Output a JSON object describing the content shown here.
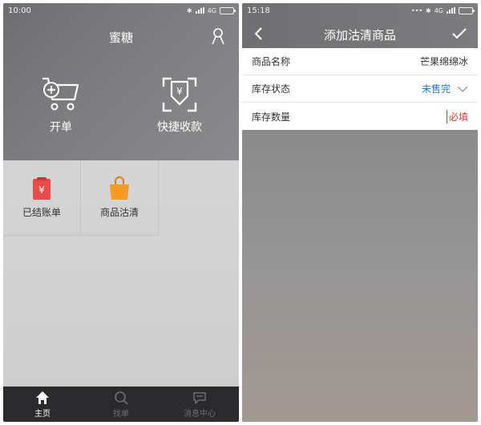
{
  "left": {
    "status": {
      "time": "10:00",
      "network": "4G"
    },
    "title": "蜜糖",
    "actions": [
      {
        "label": "开单",
        "icon": "cart-add-icon"
      },
      {
        "label": "快捷收款",
        "icon": "scan-pay-icon"
      }
    ],
    "grid": [
      {
        "label": "已结账单",
        "icon": "bill-icon",
        "color": "#e94b4b"
      },
      {
        "label": "商品沽清",
        "icon": "shopping-bag-icon",
        "color": "#f59a23"
      }
    ],
    "tabs": [
      {
        "label": "主页",
        "icon": "home-icon",
        "active": true
      },
      {
        "label": "找单",
        "icon": "search-icon",
        "active": false
      },
      {
        "label": "消息中心",
        "icon": "message-icon",
        "active": false
      }
    ]
  },
  "right": {
    "status": {
      "time": "15:18",
      "network": "4G"
    },
    "title": "添加沽清商品",
    "form": [
      {
        "label": "商品名称",
        "value": "芒果绵绵冰"
      },
      {
        "label": "库存状态",
        "value": "未售完"
      },
      {
        "label": "库存数量",
        "value": "必填"
      }
    ]
  }
}
